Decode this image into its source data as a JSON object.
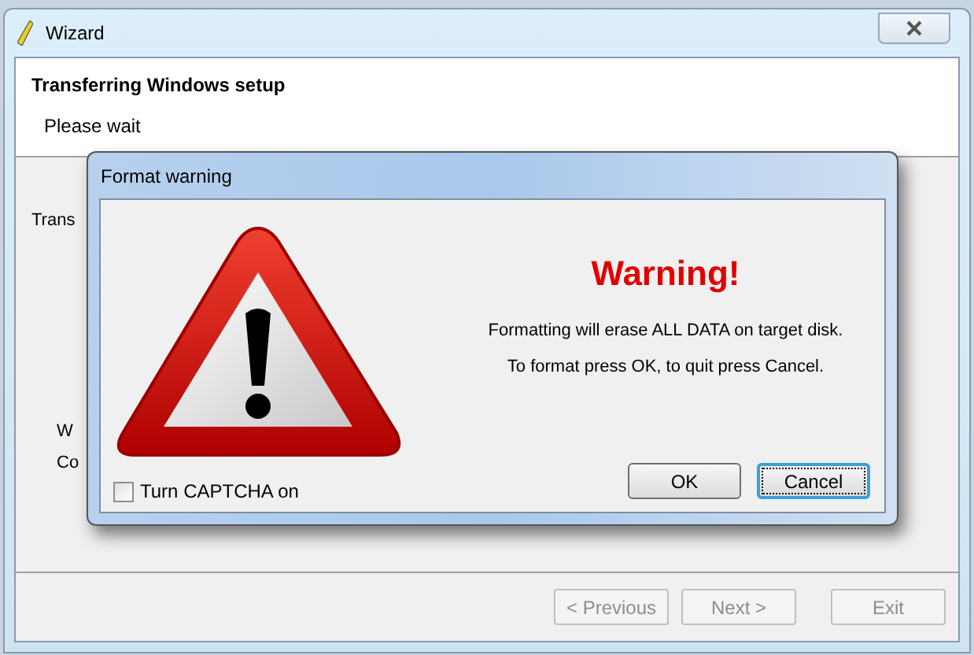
{
  "window": {
    "title": "Wizard"
  },
  "header": {
    "title": "Transferring Windows setup",
    "subtitle": "Please wait"
  },
  "body_texts": [
    {
      "text": "Trans"
    },
    {
      "text": "W"
    },
    {
      "text": "Co"
    }
  ],
  "dialog": {
    "title": "Format warning",
    "heading": "Warning!",
    "message": [
      "Formatting will erase ALL DATA on target disk.",
      "To format press OK, to quit press Cancel."
    ],
    "checkbox": {
      "label": "Turn CAPTCHA on",
      "checked": false
    },
    "buttons": [
      {
        "label": "OK",
        "focused": false
      },
      {
        "label": "Cancel",
        "focused": true
      }
    ]
  },
  "footer_buttons": [
    {
      "label": "< Previous",
      "disabled": true
    },
    {
      "label": "Next >",
      "disabled": true
    },
    {
      "label": "Exit",
      "disabled": true
    }
  ]
}
